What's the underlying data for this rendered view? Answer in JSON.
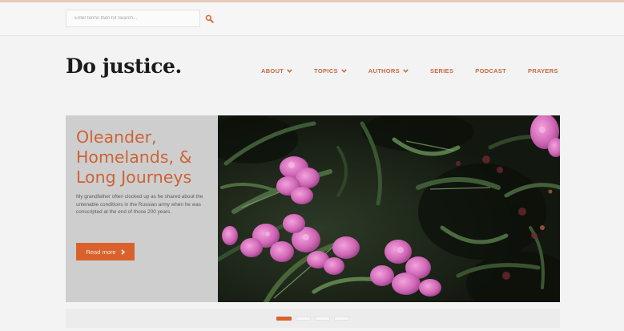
{
  "search": {
    "placeholder": "Enter terms then hit Search..."
  },
  "site": {
    "logo": "Do justice."
  },
  "nav": {
    "items": [
      {
        "label": "ABOUT",
        "has_dropdown": true
      },
      {
        "label": "TOPICS",
        "has_dropdown": true
      },
      {
        "label": "AUTHORS",
        "has_dropdown": true
      },
      {
        "label": "SERIES",
        "has_dropdown": false
      },
      {
        "label": "PODCAST",
        "has_dropdown": false
      },
      {
        "label": "PRAYERS",
        "has_dropdown": false
      }
    ]
  },
  "hero": {
    "title_lines": [
      "Oleander,",
      "Homelands, &",
      "Long Journeys"
    ],
    "description": "My grandfather often clocked up as he shared about the untenable conditions in the Russian army when he was conscripted at the end of those 200 years.",
    "read_more_label": "Read more"
  },
  "slider": {
    "slide_count": 4,
    "active_index": 0
  },
  "colors": {
    "accent": "#d9622c",
    "nav_text": "#c7693f",
    "logo_text": "#1b1b1b",
    "panel_bg": "#cecece",
    "page_bg": "#f3f3f3"
  },
  "icons": {
    "search": "magnifier-icon",
    "dropdown": "chevron-down-icon",
    "read_more": "chevron-right-icon"
  }
}
